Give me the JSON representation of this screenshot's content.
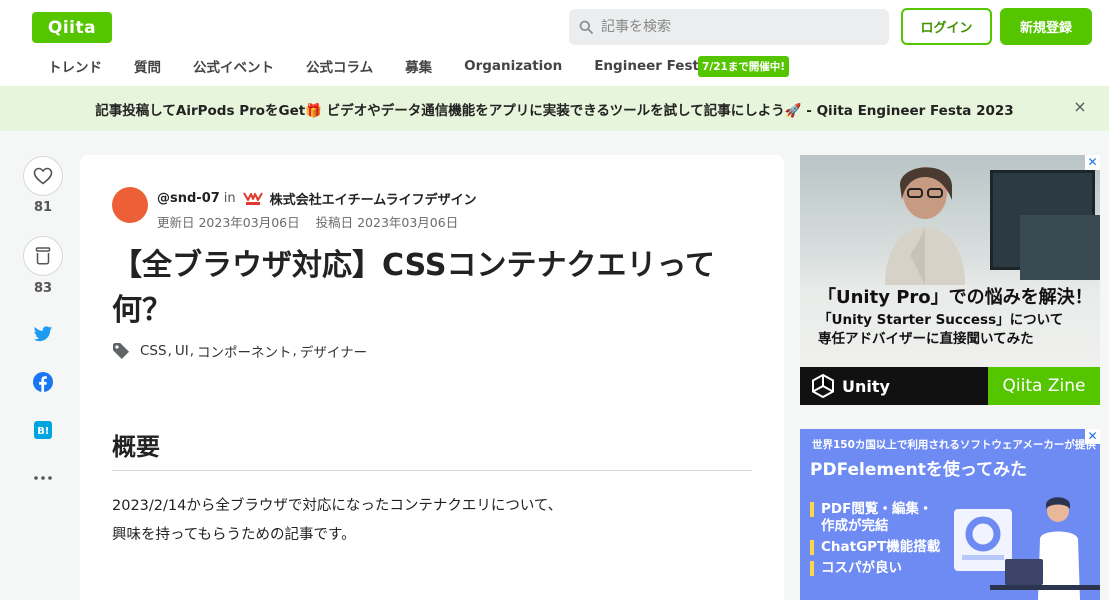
{
  "header": {
    "logo": "Qiita",
    "search_placeholder": "記事を検索",
    "login_label": "ログイン",
    "signup_label": "新規登録"
  },
  "nav": {
    "items": [
      "トレンド",
      "質問",
      "公式イベント",
      "公式コラム",
      "募集",
      "Organization",
      "Engineer Festa"
    ],
    "badge": "7/21まで開催中!"
  },
  "banner": {
    "text": "記事投稿してAirPods ProをGet🎁 ビデオやデータ通信機能をアプリに実装できるツールを試して記事にしよう🚀 - Qiita Engineer Festa 2023",
    "close": "×"
  },
  "sidebar": {
    "like_count": "81",
    "stock_count": "83",
    "icons": [
      "heart-icon",
      "stock-icon",
      "twitter-icon",
      "facebook-icon",
      "hatena-icon",
      "more-icon"
    ]
  },
  "article": {
    "author": "@snd-07",
    "in_word": "in",
    "org": "株式会社エイチームライフデザイン",
    "updated": "更新日 2023年03月06日",
    "posted": "投稿日 2023年03月06日",
    "title": "【全ブラウザ対応】CSSコンテナクエリって何？",
    "tags": [
      "CSS",
      "UI",
      "コンポーネント",
      "デザイナー"
    ],
    "heading": "概要",
    "paragraph_line1": "2023/2/14から全ブラウザで対応になったコンテナクエリについて、",
    "paragraph_line2": "興味を持ってもらうための記事です。"
  },
  "ad1": {
    "headline": "「Unity Pro」での悩みを解決！",
    "sub1": "「Unity Starter Success」について",
    "sub2": "専任アドバイザーに直接聞いてみた",
    "brand": "Unity",
    "partner": "Qiita Zine"
  },
  "ad2": {
    "top": "世界150カ国以上で利用されるソフトウェアメーカーが提供",
    "headline": "PDFelementを使ってみた",
    "points": [
      "PDF閲覧・編集・",
      "作成が完結",
      "ChatGPT機能搭載",
      "コスパが良い"
    ]
  },
  "colors": {
    "brand": "#55c500",
    "banner_bg": "#e7f5dc",
    "avatar": "#ec5f37",
    "twitter": "#1d9bf0",
    "facebook": "#1877f2",
    "hatena": "#00a4de"
  }
}
